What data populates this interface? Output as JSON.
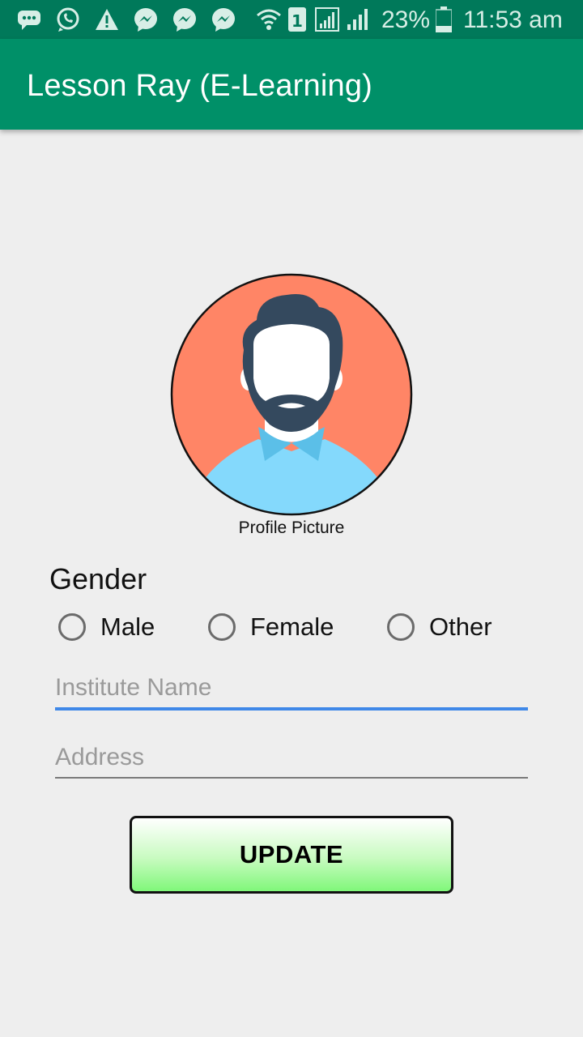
{
  "status_bar": {
    "icons": [
      "sms-icon",
      "whatsapp-icon",
      "warning-icon",
      "messenger-icon",
      "messenger-icon",
      "messenger-icon",
      "wifi-icon",
      "sim-1-icon",
      "signal-icon",
      "signal-icon",
      "battery-icon"
    ],
    "battery": "23%",
    "time": "11:53 am"
  },
  "app_bar": {
    "title": "Lesson Ray (E-Learning)"
  },
  "profile": {
    "caption": "Profile Picture",
    "avatar_bg_color": "#ff8566",
    "shirt_color": "#84d9fc",
    "hair_color": "#34495e"
  },
  "gender": {
    "label": "Gender",
    "options": [
      "Male",
      "Female",
      "Other"
    ]
  },
  "form": {
    "institute_placeholder": "Institute Name",
    "address_placeholder": "Address"
  },
  "button": {
    "label": "UPDATE"
  },
  "colors": {
    "status_bar": "#00795a",
    "app_bar": "#009068",
    "focus_underline": "#3f88e8"
  }
}
